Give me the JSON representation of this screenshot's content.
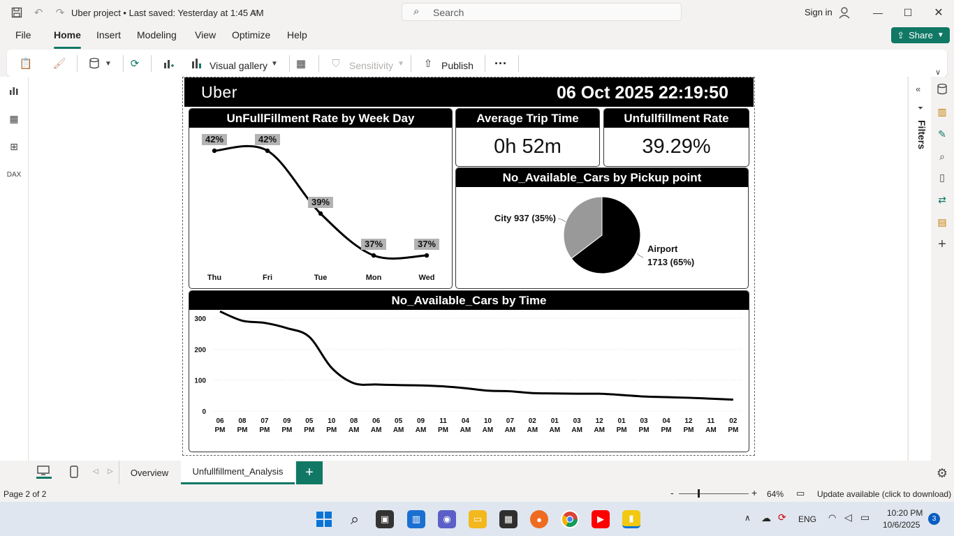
{
  "titlebar": {
    "title": "Uber project • Last saved: Yesterday at 1:45 AM",
    "search_placeholder": "Search",
    "signin_label": "Sign in"
  },
  "menu": {
    "items": [
      "File",
      "Home",
      "Insert",
      "Modeling",
      "View",
      "Optimize",
      "Help"
    ],
    "active": "Home",
    "share_label": "Share"
  },
  "ribbon": {
    "visual_gallery_label": "Visual gallery",
    "sensitivity_label": "Sensitivity",
    "publish_label": "Publish",
    "more_label": "···"
  },
  "side_panel": {
    "filters_label": "Filters"
  },
  "report": {
    "logo_text": "Uber",
    "timestamp": "06 Oct 2025 22:19:50",
    "weekday_card": {
      "title": "UnFullFillment Rate by Week Day"
    },
    "avg_trip_card": {
      "title": "Average Trip Time",
      "value": "0h 52m"
    },
    "unfull_rate_card": {
      "title": "Unfullfillment Rate",
      "value": "39.29%"
    },
    "pickup_card": {
      "title": "No_Available_Cars by Pickup point"
    },
    "time_card": {
      "title": "No_Available_Cars by Time"
    }
  },
  "chart_data": [
    {
      "type": "line",
      "title": "UnFullFillment Rate by Week Day",
      "categories": [
        "Thu",
        "Fri",
        "Tue",
        "Mon",
        "Wed"
      ],
      "values": [
        42,
        42,
        39,
        37,
        37
      ],
      "value_labels": [
        "42%",
        "42%",
        "39%",
        "37%",
        "37%"
      ],
      "unit": "%",
      "grid": false
    },
    {
      "type": "pie",
      "title": "No_Available_Cars by Pickup point",
      "slices": [
        {
          "name": "Airport",
          "value": 1713,
          "label": "Airport",
          "detail": "1713 (65%)",
          "color": "#000000"
        },
        {
          "name": "City",
          "value": 937,
          "label": "City 937 (35%)",
          "color": "#999999"
        }
      ]
    },
    {
      "type": "line",
      "title": "No_Available_Cars by Time",
      "categories": [
        [
          "06",
          "PM"
        ],
        [
          "08",
          "PM"
        ],
        [
          "07",
          "PM"
        ],
        [
          "09",
          "PM"
        ],
        [
          "05",
          "PM"
        ],
        [
          "10",
          "PM"
        ],
        [
          "08",
          "AM"
        ],
        [
          "06",
          "AM"
        ],
        [
          "05",
          "AM"
        ],
        [
          "09",
          "AM"
        ],
        [
          "11",
          "PM"
        ],
        [
          "04",
          "AM"
        ],
        [
          "10",
          "AM"
        ],
        [
          "07",
          "AM"
        ],
        [
          "02",
          "AM"
        ],
        [
          "01",
          "AM"
        ],
        [
          "03",
          "AM"
        ],
        [
          "12",
          "AM"
        ],
        [
          "01",
          "PM"
        ],
        [
          "03",
          "PM"
        ],
        [
          "04",
          "PM"
        ],
        [
          "12",
          "PM"
        ],
        [
          "11",
          "AM"
        ],
        [
          "02",
          "PM"
        ]
      ],
      "values": [
        322,
        292,
        285,
        268,
        240,
        140,
        90,
        86,
        84,
        83,
        80,
        74,
        66,
        64,
        58,
        57,
        56,
        56,
        52,
        47,
        45,
        43,
        40,
        37
      ],
      "yticks": [
        0,
        100,
        200,
        300
      ],
      "ylim": [
        0,
        340
      ],
      "grid": true
    }
  ],
  "pages": {
    "tabs": [
      "Overview",
      "Unfullfillment_Analysis"
    ],
    "active": "Unfullfillment_Analysis"
  },
  "status": {
    "page_info": "Page 2 of 2",
    "zoom": "64%",
    "update": "Update available (click to download)"
  },
  "taskbar": {
    "lang": "ENG",
    "time": "10:20 PM",
    "date": "10/6/2025",
    "badge": "3"
  },
  "colors": {
    "accent": "#117865",
    "header_bg": "#000000"
  }
}
